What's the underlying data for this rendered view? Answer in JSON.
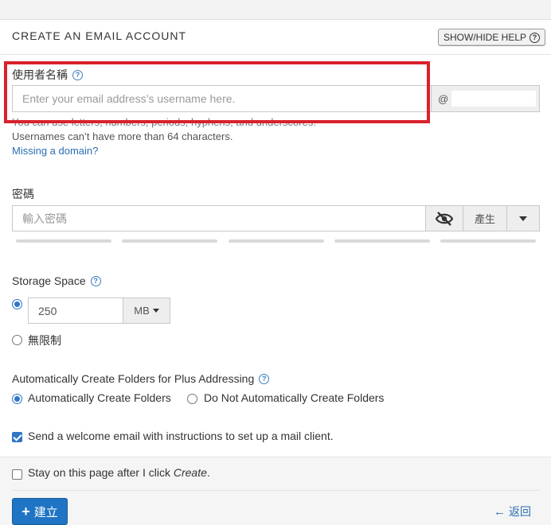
{
  "header": {
    "title": "CREATE AN EMAIL ACCOUNT",
    "help_button": "SHOW/HIDE HELP"
  },
  "username": {
    "label": "使用者名稱",
    "placeholder": "Enter your email address’s username here.",
    "at": "@",
    "help_1": "You can use letters, numbers, periods, hyphens, and underscores.",
    "help_2": "Usernames can’t have more than 64 characters.",
    "missing_domain_link": "Missing a domain?"
  },
  "password": {
    "label": "密碼",
    "placeholder": "輸入密碼",
    "generate_label": "產生"
  },
  "storage": {
    "label": "Storage Space",
    "value": "250",
    "unit": "MB",
    "unlimited_label": "無限制",
    "selected": "limited"
  },
  "folders": {
    "label": "Automatically Create Folders for Plus Addressing",
    "option_auto": "Automatically Create Folders",
    "option_no": "Do Not Automatically Create Folders",
    "selected": "auto"
  },
  "welcome_email": {
    "label": "Send a welcome email with instructions to set up a mail client.",
    "checked": true
  },
  "footer": {
    "stay_prefix": "Stay on this page after I click ",
    "stay_em": "Create",
    "stay_suffix": ".",
    "stay_checked": false,
    "create_label": "建立",
    "back_label": "返回"
  },
  "colors": {
    "accent": "#1f74c4",
    "highlight": "#d9212b",
    "link": "#2a6fb3"
  }
}
